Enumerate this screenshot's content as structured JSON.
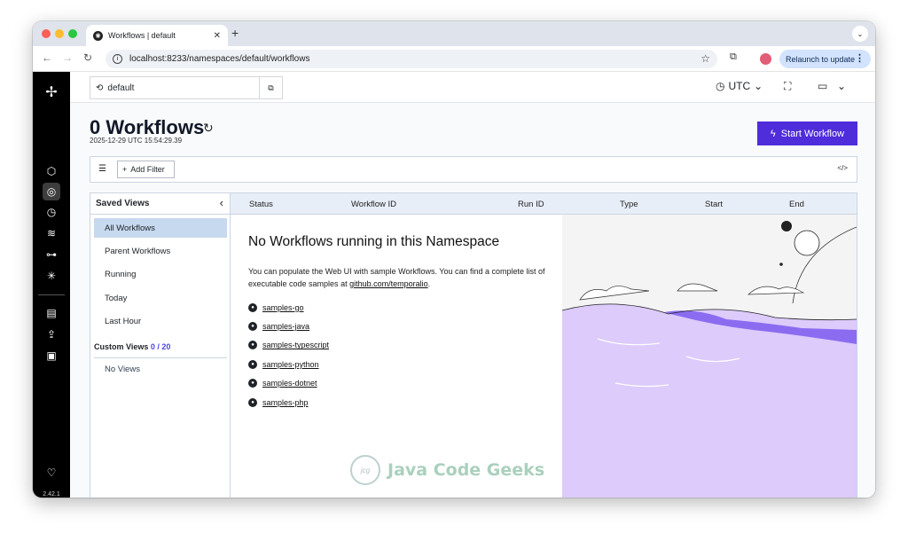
{
  "browser": {
    "tab_title": "Workflows | default",
    "url": "localhost:8233/namespaces/default/workflows",
    "relaunch_label": "Relaunch to update"
  },
  "rail": {
    "version": "2.42.1"
  },
  "topbar": {
    "namespace": "default",
    "timezone": "UTC"
  },
  "header": {
    "title": "0 Workflows",
    "timestamp": "2025-12-29 UTC 15:54:29.39",
    "start_button": "Start Workflow"
  },
  "filter": {
    "add_filter": "Add Filter"
  },
  "saved_views": {
    "title": "Saved Views",
    "items": [
      "All Workflows",
      "Parent Workflows",
      "Running",
      "Today",
      "Last Hour"
    ],
    "active_index": 0,
    "custom_title": "Custom Views",
    "custom_count": "0 / 20",
    "no_views": "No Views"
  },
  "table": {
    "columns": [
      "Status",
      "Workflow ID",
      "Run ID",
      "Type",
      "Start",
      "End"
    ]
  },
  "empty": {
    "heading": "No Workflows running in this Namespace",
    "text": "You can populate the Web UI with sample Workflows. You can find a complete list of executable code samples at",
    "link": "github.com/temporalio",
    "period": ".",
    "samples": [
      "samples-go",
      "samples-java",
      "samples-typescript",
      "samples-python",
      "samples-dotnet",
      "samples-php"
    ]
  },
  "watermark": {
    "text": "Java Code Geeks",
    "logo": "jcg"
  },
  "colors": {
    "accent": "#4f2ddb",
    "rail": "#000000",
    "active_view": "#c7d9ef",
    "art_purple": "#dccbfb"
  }
}
